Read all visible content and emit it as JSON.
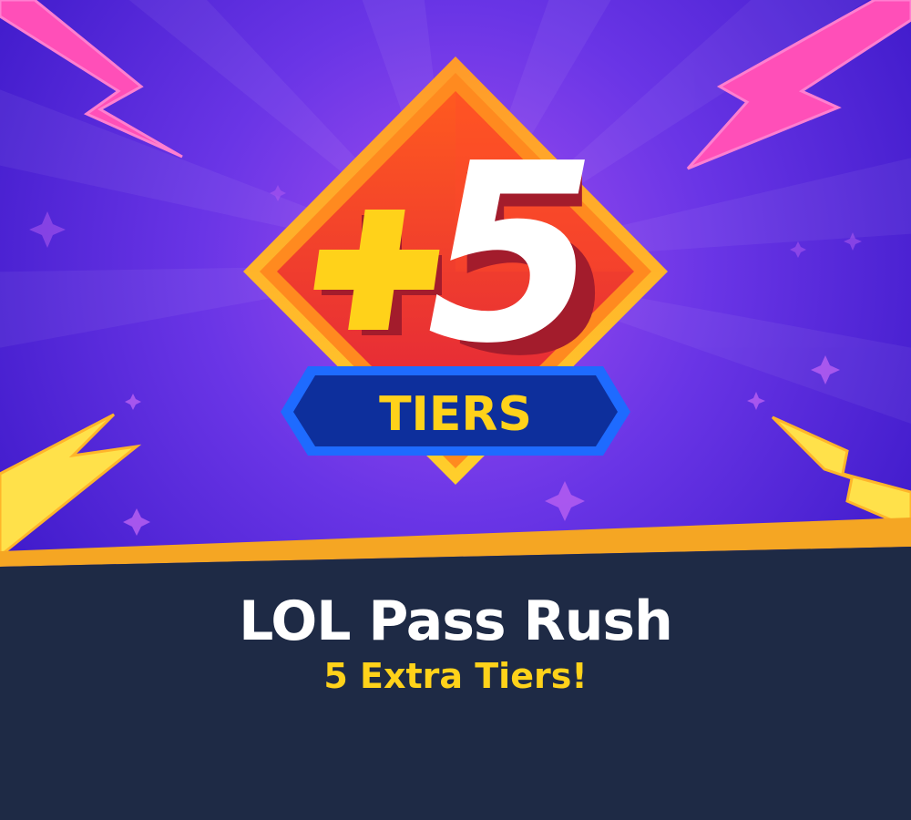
{
  "badge": {
    "plus_text": "+",
    "number_text": "5",
    "ribbon_text": "TIERS"
  },
  "offer": {
    "title": "LOL Pass Rush",
    "subtitle": "5 Extra Tiers!"
  },
  "colors": {
    "background_purple": "#5b2ee0",
    "bottom_panel": "#1e2a45",
    "orange_stripe": "#f5a623",
    "diamond_red": "#e8283a",
    "diamond_orange": "#ff8a1f",
    "ribbon_blue": "#0d2f9c",
    "ribbon_border": "#1e6bff",
    "accent_yellow": "#ffd21a",
    "lightning_pink": "#ff4fb8",
    "lightning_yellow": "#ffe14a"
  }
}
